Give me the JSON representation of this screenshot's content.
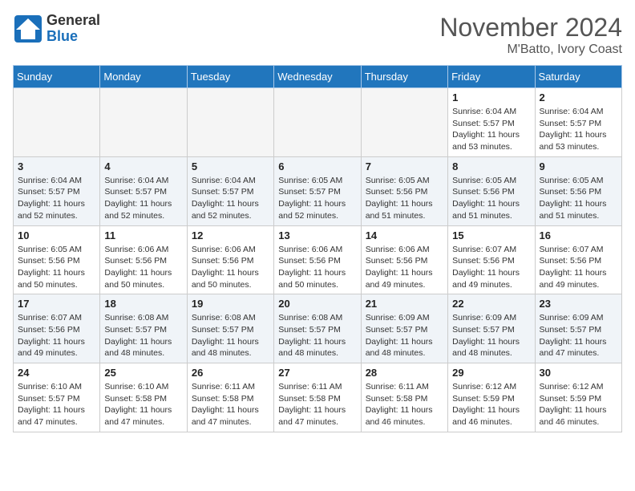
{
  "header": {
    "logo_general": "General",
    "logo_blue": "Blue",
    "month_year": "November 2024",
    "location": "M'Batto, Ivory Coast"
  },
  "weekdays": [
    "Sunday",
    "Monday",
    "Tuesday",
    "Wednesday",
    "Thursday",
    "Friday",
    "Saturday"
  ],
  "weeks": [
    [
      {
        "day": "",
        "empty": true
      },
      {
        "day": "",
        "empty": true
      },
      {
        "day": "",
        "empty": true
      },
      {
        "day": "",
        "empty": true
      },
      {
        "day": "",
        "empty": true
      },
      {
        "day": "1",
        "sunrise": "6:04 AM",
        "sunset": "5:57 PM",
        "daylight": "11 hours and 53 minutes."
      },
      {
        "day": "2",
        "sunrise": "6:04 AM",
        "sunset": "5:57 PM",
        "daylight": "11 hours and 53 minutes."
      }
    ],
    [
      {
        "day": "3",
        "sunrise": "6:04 AM",
        "sunset": "5:57 PM",
        "daylight": "11 hours and 52 minutes."
      },
      {
        "day": "4",
        "sunrise": "6:04 AM",
        "sunset": "5:57 PM",
        "daylight": "11 hours and 52 minutes."
      },
      {
        "day": "5",
        "sunrise": "6:04 AM",
        "sunset": "5:57 PM",
        "daylight": "11 hours and 52 minutes."
      },
      {
        "day": "6",
        "sunrise": "6:05 AM",
        "sunset": "5:57 PM",
        "daylight": "11 hours and 52 minutes."
      },
      {
        "day": "7",
        "sunrise": "6:05 AM",
        "sunset": "5:56 PM",
        "daylight": "11 hours and 51 minutes."
      },
      {
        "day": "8",
        "sunrise": "6:05 AM",
        "sunset": "5:56 PM",
        "daylight": "11 hours and 51 minutes."
      },
      {
        "day": "9",
        "sunrise": "6:05 AM",
        "sunset": "5:56 PM",
        "daylight": "11 hours and 51 minutes."
      }
    ],
    [
      {
        "day": "10",
        "sunrise": "6:05 AM",
        "sunset": "5:56 PM",
        "daylight": "11 hours and 50 minutes."
      },
      {
        "day": "11",
        "sunrise": "6:06 AM",
        "sunset": "5:56 PM",
        "daylight": "11 hours and 50 minutes."
      },
      {
        "day": "12",
        "sunrise": "6:06 AM",
        "sunset": "5:56 PM",
        "daylight": "11 hours and 50 minutes."
      },
      {
        "day": "13",
        "sunrise": "6:06 AM",
        "sunset": "5:56 PM",
        "daylight": "11 hours and 50 minutes."
      },
      {
        "day": "14",
        "sunrise": "6:06 AM",
        "sunset": "5:56 PM",
        "daylight": "11 hours and 49 minutes."
      },
      {
        "day": "15",
        "sunrise": "6:07 AM",
        "sunset": "5:56 PM",
        "daylight": "11 hours and 49 minutes."
      },
      {
        "day": "16",
        "sunrise": "6:07 AM",
        "sunset": "5:56 PM",
        "daylight": "11 hours and 49 minutes."
      }
    ],
    [
      {
        "day": "17",
        "sunrise": "6:07 AM",
        "sunset": "5:56 PM",
        "daylight": "11 hours and 49 minutes."
      },
      {
        "day": "18",
        "sunrise": "6:08 AM",
        "sunset": "5:57 PM",
        "daylight": "11 hours and 48 minutes."
      },
      {
        "day": "19",
        "sunrise": "6:08 AM",
        "sunset": "5:57 PM",
        "daylight": "11 hours and 48 minutes."
      },
      {
        "day": "20",
        "sunrise": "6:08 AM",
        "sunset": "5:57 PM",
        "daylight": "11 hours and 48 minutes."
      },
      {
        "day": "21",
        "sunrise": "6:09 AM",
        "sunset": "5:57 PM",
        "daylight": "11 hours and 48 minutes."
      },
      {
        "day": "22",
        "sunrise": "6:09 AM",
        "sunset": "5:57 PM",
        "daylight": "11 hours and 48 minutes."
      },
      {
        "day": "23",
        "sunrise": "6:09 AM",
        "sunset": "5:57 PM",
        "daylight": "11 hours and 47 minutes."
      }
    ],
    [
      {
        "day": "24",
        "sunrise": "6:10 AM",
        "sunset": "5:57 PM",
        "daylight": "11 hours and 47 minutes."
      },
      {
        "day": "25",
        "sunrise": "6:10 AM",
        "sunset": "5:58 PM",
        "daylight": "11 hours and 47 minutes."
      },
      {
        "day": "26",
        "sunrise": "6:11 AM",
        "sunset": "5:58 PM",
        "daylight": "11 hours and 47 minutes."
      },
      {
        "day": "27",
        "sunrise": "6:11 AM",
        "sunset": "5:58 PM",
        "daylight": "11 hours and 47 minutes."
      },
      {
        "day": "28",
        "sunrise": "6:11 AM",
        "sunset": "5:58 PM",
        "daylight": "11 hours and 46 minutes."
      },
      {
        "day": "29",
        "sunrise": "6:12 AM",
        "sunset": "5:59 PM",
        "daylight": "11 hours and 46 minutes."
      },
      {
        "day": "30",
        "sunrise": "6:12 AM",
        "sunset": "5:59 PM",
        "daylight": "11 hours and 46 minutes."
      }
    ]
  ],
  "labels": {
    "sunrise": "Sunrise:",
    "sunset": "Sunset:",
    "daylight": "Daylight:"
  }
}
